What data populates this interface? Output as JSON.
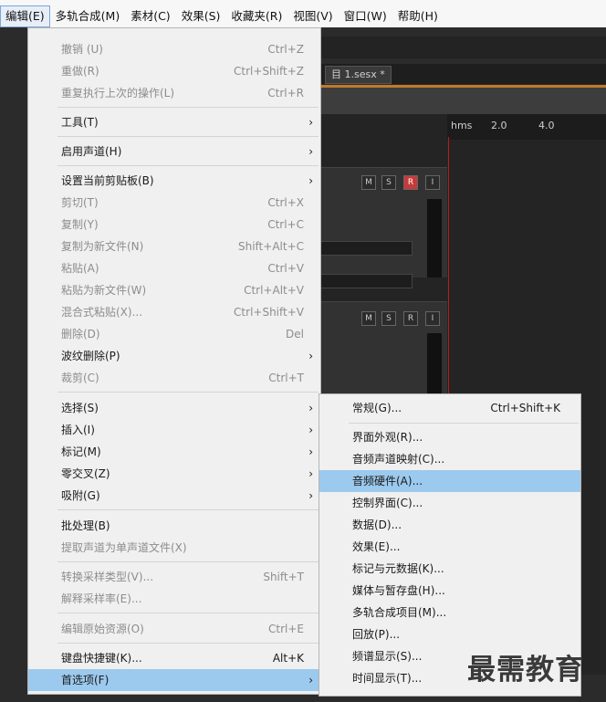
{
  "menubar": [
    {
      "label": "编辑(E)",
      "active": true
    },
    {
      "label": "多轨合成(M)"
    },
    {
      "label": "素材(C)"
    },
    {
      "label": "效果(S)"
    },
    {
      "label": "收藏夹(R)"
    },
    {
      "label": "视图(V)"
    },
    {
      "label": "窗口(W)"
    },
    {
      "label": "帮助(H)"
    }
  ],
  "background": {
    "tab_label": "目 1.sesx *",
    "timeline": {
      "unit": "hms",
      "t1": "2.0",
      "t2": "4.0"
    },
    "track_buttons": [
      "M",
      "S",
      "R",
      "I"
    ]
  },
  "edit_menu": {
    "items": [
      {
        "label": "撤销 (U)",
        "shortcut": "Ctrl+Z",
        "disabled": true
      },
      {
        "label": "重做(R)",
        "shortcut": "Ctrl+Shift+Z",
        "disabled": true
      },
      {
        "label": "重复执行上次的操作(L)",
        "shortcut": "Ctrl+R",
        "disabled": true
      },
      {
        "label": "工具(T)",
        "arrow": "›"
      },
      {
        "label": "启用声道(H)",
        "arrow": "›"
      },
      {
        "label": "设置当前剪贴板(B)",
        "arrow": "›"
      },
      {
        "label": "剪切(T)",
        "shortcut": "Ctrl+X",
        "disabled": true
      },
      {
        "label": "复制(Y)",
        "shortcut": "Ctrl+C",
        "disabled": true
      },
      {
        "label": "复制为新文件(N)",
        "shortcut": "Shift+Alt+C",
        "disabled": true
      },
      {
        "label": "粘贴(A)",
        "shortcut": "Ctrl+V",
        "disabled": true
      },
      {
        "label": "粘贴为新文件(W)",
        "shortcut": "Ctrl+Alt+V",
        "disabled": true
      },
      {
        "label": "混合式粘贴(X)...",
        "shortcut": "Ctrl+Shift+V",
        "disabled": true
      },
      {
        "label": "删除(D)",
        "shortcut": "Del",
        "disabled": true
      },
      {
        "label": "波纹删除(P)",
        "arrow": "›"
      },
      {
        "label": "裁剪(C)",
        "shortcut": "Ctrl+T",
        "disabled": true
      },
      {
        "label": "选择(S)",
        "arrow": "›"
      },
      {
        "label": "插入(I)",
        "arrow": "›"
      },
      {
        "label": "标记(M)",
        "arrow": "›"
      },
      {
        "label": "零交叉(Z)",
        "arrow": "›"
      },
      {
        "label": "吸附(G)",
        "arrow": "›"
      },
      {
        "label": "批处理(B)"
      },
      {
        "label": "提取声道为单声道文件(X)",
        "disabled": true
      },
      {
        "label": "转换采样类型(V)...",
        "shortcut": "Shift+T",
        "disabled": true
      },
      {
        "label": "解释采样率(E)...",
        "disabled": true
      },
      {
        "label": "编辑原始资源(O)",
        "shortcut": "Ctrl+E",
        "disabled": true
      },
      {
        "label": "键盘快捷键(K)...",
        "shortcut": "Alt+K"
      },
      {
        "label": "首选项(F)",
        "arrow": "›",
        "highlighted": true
      }
    ]
  },
  "preferences_submenu": {
    "items": [
      {
        "label": "常规(G)...",
        "shortcut": "Ctrl+Shift+K"
      },
      {
        "label": "界面外观(R)..."
      },
      {
        "label": "音频声道映射(C)..."
      },
      {
        "label": "音频硬件(A)...",
        "highlighted": true
      },
      {
        "label": "控制界面(C)..."
      },
      {
        "label": "数据(D)..."
      },
      {
        "label": "效果(E)..."
      },
      {
        "label": "标记与元数据(K)..."
      },
      {
        "label": "媒体与暂存盘(H)..."
      },
      {
        "label": "多轨合成项目(M)..."
      },
      {
        "label": "回放(P)..."
      },
      {
        "label": "频谱显示(S)..."
      },
      {
        "label": "时间显示(T)..."
      }
    ]
  },
  "watermark": "最需教育"
}
